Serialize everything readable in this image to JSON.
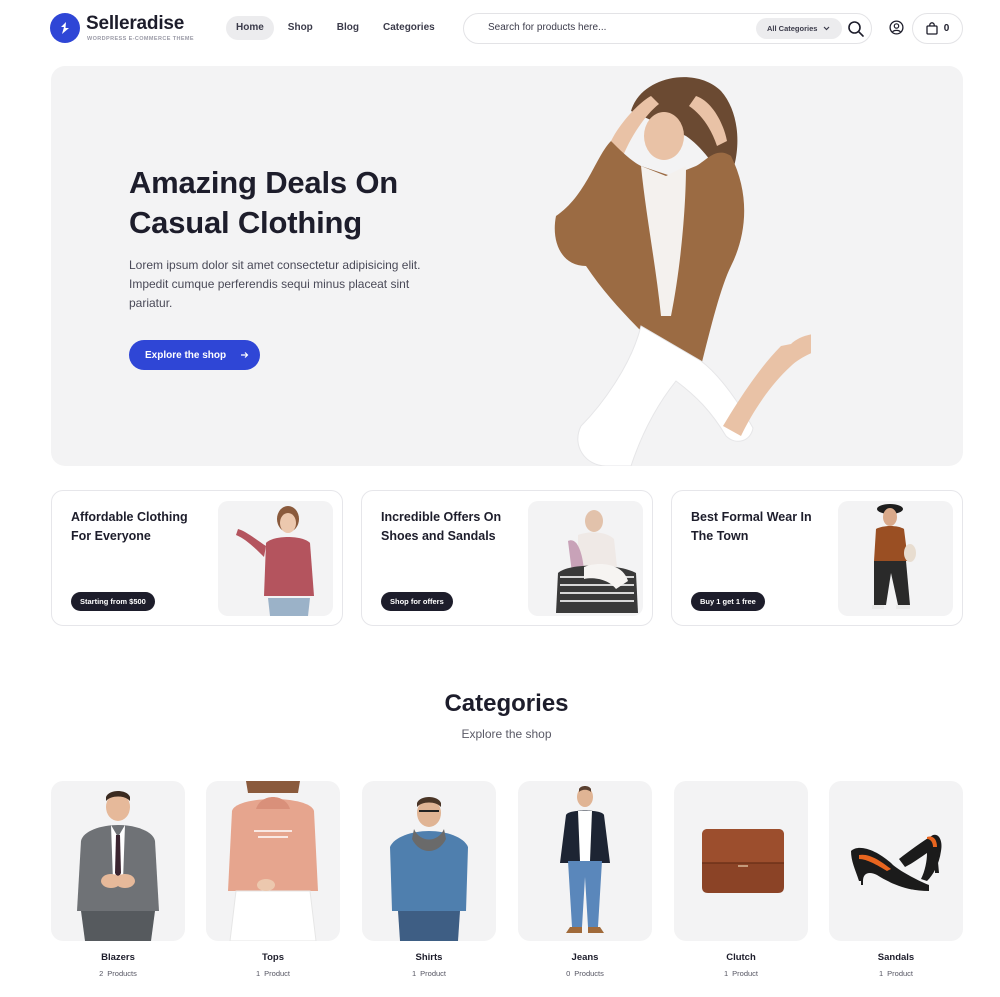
{
  "brand": {
    "name": "Selleradise",
    "tagline": "WORDPRESS E-COMMERCE THEME",
    "accent": "#2f46d6"
  },
  "nav": {
    "items": [
      {
        "label": "Home",
        "active": true
      },
      {
        "label": "Shop"
      },
      {
        "label": "Blog"
      },
      {
        "label": "Categories"
      }
    ]
  },
  "search": {
    "placeholder": "Search for products here...",
    "category": "All Categories"
  },
  "cart": {
    "count": "0"
  },
  "hero": {
    "title": "Amazing Deals On Casual Clothing",
    "text": "Lorem ipsum dolor sit amet consectetur adipisicing elit. Impedit cumque perferendis sequi minus placeat sint pariatur.",
    "button": "Explore the shop"
  },
  "promos": [
    {
      "title": "Affordable Clothing For Everyone",
      "badge": "Starting from $500"
    },
    {
      "title": "Incredible Offers On Shoes and Sandals",
      "badge": "Shop for offers"
    },
    {
      "title": "Best Formal Wear In The Town",
      "badge": "Buy 1 get 1 free"
    }
  ],
  "categories": {
    "title": "Categories",
    "subtitle": "Explore the shop",
    "items": [
      {
        "name": "Blazers",
        "count": "2",
        "unit": "Products"
      },
      {
        "name": "Tops",
        "count": "1",
        "unit": "Product"
      },
      {
        "name": "Shirts",
        "count": "1",
        "unit": "Product"
      },
      {
        "name": "Jeans",
        "count": "0",
        "unit": "Products"
      },
      {
        "name": "Clutch",
        "count": "1",
        "unit": "Product"
      },
      {
        "name": "Sandals",
        "count": "1",
        "unit": "Product"
      }
    ]
  }
}
